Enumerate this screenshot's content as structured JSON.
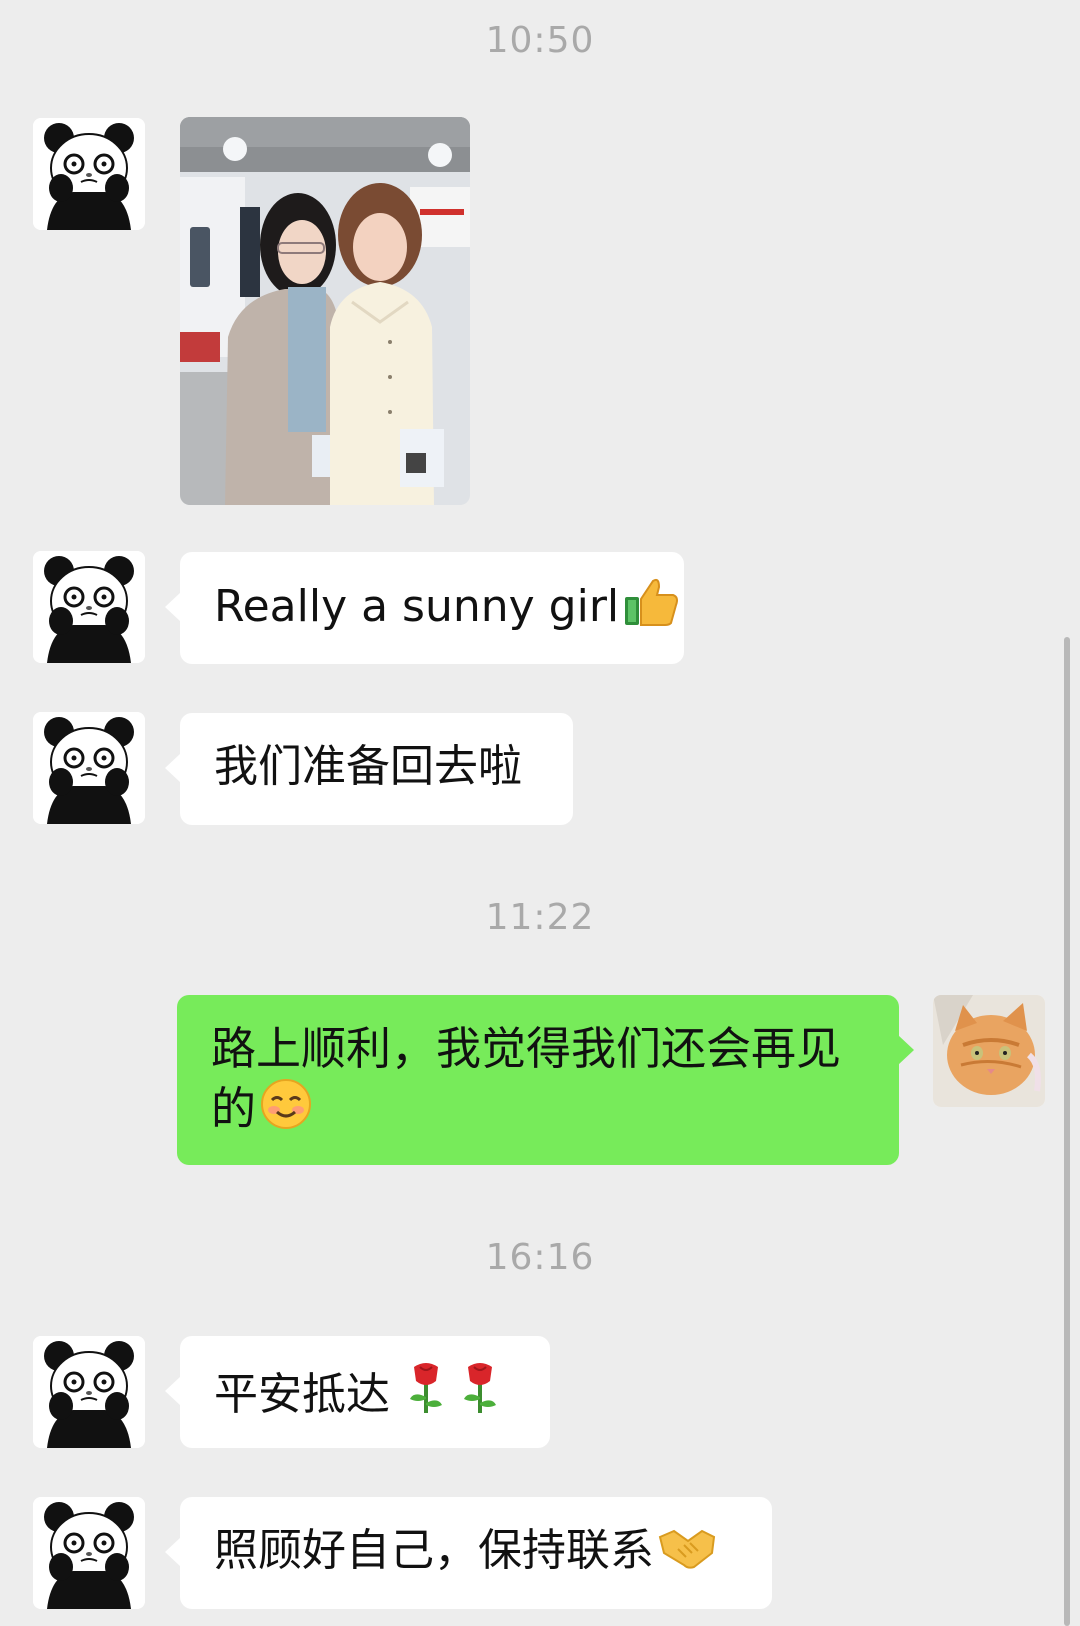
{
  "colors": {
    "background": "#ededed",
    "incoming_bubble": "#ffffff",
    "outgoing_bubble": "#77eb5a",
    "timestamp_text": "#a9a9a9"
  },
  "timestamps": [
    "10:50",
    "11:22",
    "16:16"
  ],
  "messages": [
    {
      "sender": "panda",
      "type": "image",
      "avatar": "panda-avatar-icon"
    },
    {
      "sender": "panda",
      "type": "text",
      "text": "Really a sunny girl",
      "emoji": "thumbs-up-icon"
    },
    {
      "sender": "panda",
      "type": "text",
      "text": "我们准备回去啦"
    },
    {
      "sender": "me",
      "type": "text",
      "line1": "路上顺利，我觉得我们还会再见",
      "line2": "的",
      "emoji": "smiling-face-icon",
      "avatar": "cat-avatar-icon"
    },
    {
      "sender": "panda",
      "type": "text",
      "text": "平安抵达",
      "emoji": "rose-icon"
    },
    {
      "sender": "panda",
      "type": "text",
      "text": "照顾好自己，保持联系",
      "emoji": "handshake-icon"
    }
  ]
}
